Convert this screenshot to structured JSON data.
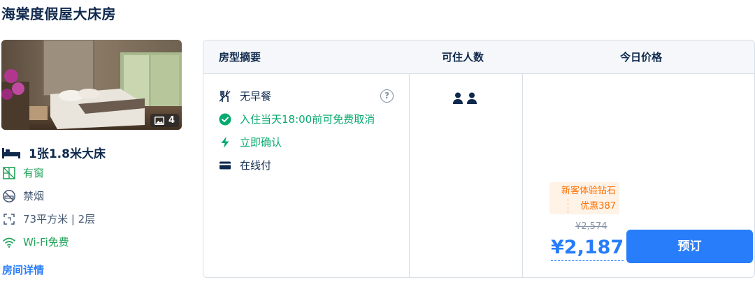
{
  "room": {
    "title": "海棠度假屋大床房",
    "photo_count": "4",
    "bed": "1张1.8米大床",
    "features": {
      "window": "有窗",
      "smoking": "禁烟",
      "area_floor": "73平方米 | 2层",
      "wifi": "Wi-Fi免费"
    },
    "details_link": "房间详情"
  },
  "table": {
    "headers": {
      "summary": "房型摘要",
      "guests": "可住人数",
      "price": "今日价格"
    },
    "policies": {
      "meal": "无早餐",
      "help": "?",
      "cancel": "入住当天18:00前可免费取消",
      "confirm": "立即确认",
      "payment": "在线付"
    },
    "guest_count": 2,
    "promo": {
      "line1": "新客体验钻石",
      "line2": "优惠387"
    },
    "original_price": "¥2,574",
    "price": "¥2,187",
    "book_label": "预订"
  },
  "colors": {
    "accent": "#287dfa",
    "green": "#06aa6e",
    "orange": "#ff6f00",
    "text": "#0f294d"
  }
}
